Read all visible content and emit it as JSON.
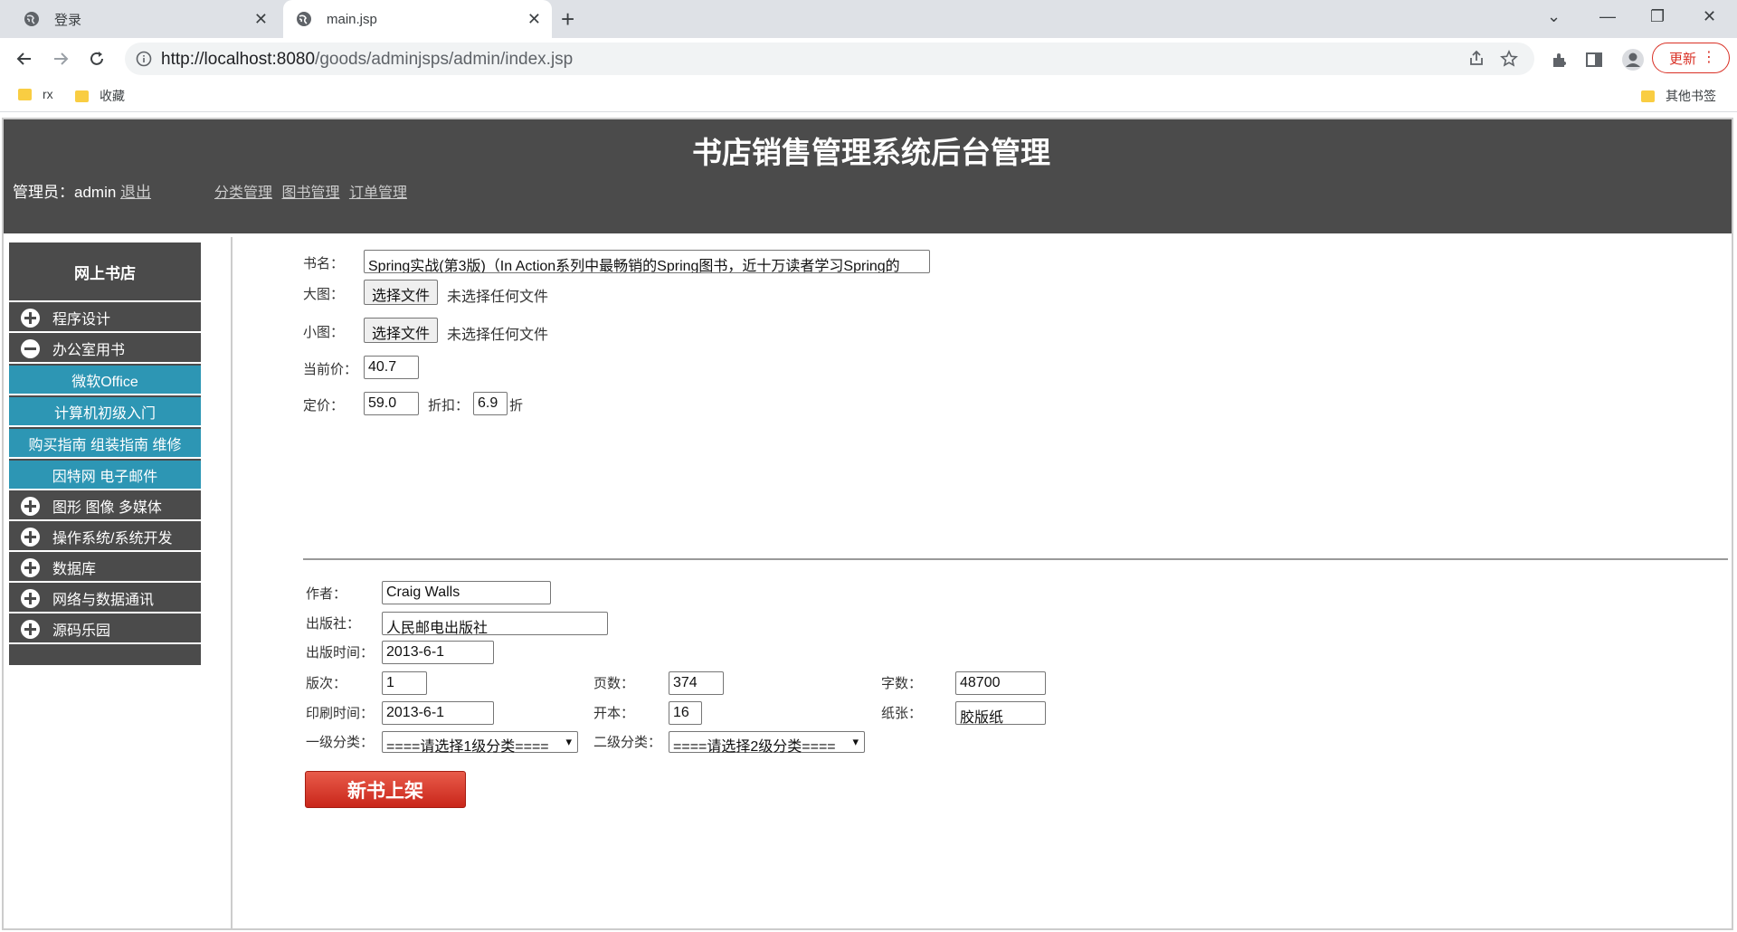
{
  "browser": {
    "tabs": [
      {
        "title": "登录",
        "active": false
      },
      {
        "title": "main.jsp",
        "active": true
      }
    ],
    "url_host": "http://localhost:8080",
    "url_path": "/goods/adminjsps/admin/index.jsp",
    "update_label": "更新",
    "bookmarks": [
      "rx",
      "收藏"
    ],
    "other_bookmarks": "其他书签"
  },
  "header": {
    "title": "书店销售管理系统后台管理",
    "admin_prefix": "管理员：admin",
    "logout": "退出",
    "nav": [
      "分类管理",
      "图书管理",
      "订单管理"
    ]
  },
  "sidebar": {
    "title": "网上书店",
    "categories": [
      {
        "label": "程序设计",
        "expanded": false
      },
      {
        "label": "办公室用书",
        "expanded": true,
        "children": [
          "微软Office",
          "计算机初级入门",
          "购买指南 组装指南 维修",
          "因特网 电子邮件"
        ]
      },
      {
        "label": "图形 图像 多媒体",
        "expanded": false
      },
      {
        "label": "操作系统/系统开发",
        "expanded": false
      },
      {
        "label": "数据库",
        "expanded": false
      },
      {
        "label": "网络与数据通讯",
        "expanded": false
      },
      {
        "label": "源码乐园",
        "expanded": false
      }
    ]
  },
  "form": {
    "name_label": "书名：",
    "name_value": "Spring实战(第3版)（In Action系列中最畅销的Spring图书，近十万读者学习Spring的",
    "big_image_label": "大图：",
    "small_image_label": "小图：",
    "choose_file": "选择文件",
    "no_file": "未选择任何文件",
    "current_price_label": "当前价：",
    "current_price": "40.7",
    "price_label": "定价：",
    "price": "59.0",
    "discount_label": "折扣：",
    "discount": "6.9",
    "discount_unit": "折",
    "author_label": "作者：",
    "author": "Craig Walls",
    "press_label": "出版社：",
    "press": "人民邮电出版社",
    "publish_time_label": "出版时间：",
    "publish_time": "2013-6-1",
    "edition_label": "版次：",
    "edition": "1",
    "pages_label": "页数：",
    "pages": "374",
    "words_label": "字数：",
    "words": "48700",
    "print_time_label": "印刷时间：",
    "print_time": "2013-6-1",
    "format_label": "开本：",
    "format": "16",
    "paper_label": "纸张：",
    "paper": "胶版纸",
    "cat1_label": "一级分类：",
    "cat1_value": "====请选择1级分类====",
    "cat2_label": "二级分类：",
    "cat2_value": "====请选择2级分类====",
    "submit": "新书上架"
  },
  "colors": {
    "header_bg": "#4b4b4b",
    "submenu_bg": "#2d96b4",
    "submit_red": "#d9382a"
  }
}
